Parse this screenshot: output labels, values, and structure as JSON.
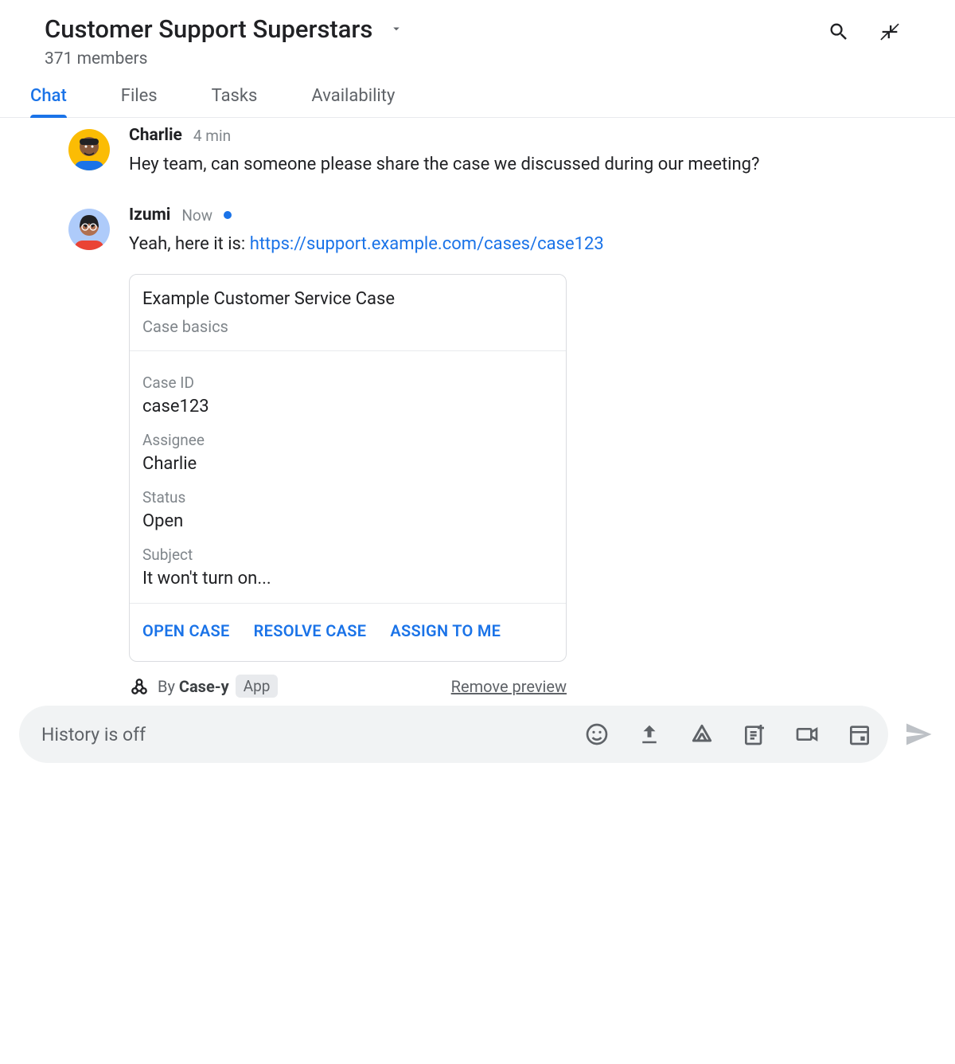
{
  "header": {
    "title": "Customer Support Superstars",
    "members": "371 members"
  },
  "tabs": [
    {
      "label": "Chat",
      "active": true
    },
    {
      "label": "Files",
      "active": false
    },
    {
      "label": "Tasks",
      "active": false
    },
    {
      "label": "Availability",
      "active": false
    }
  ],
  "messages": [
    {
      "sender": "Charlie",
      "time": "4 min",
      "text": "Hey team, can someone please share the case we discussed during our meeting?"
    },
    {
      "sender": "Izumi",
      "time": "Now",
      "new": true,
      "text_prefix": "Yeah, here it is: ",
      "link_text": "https://support.example.com/cases/case123"
    }
  ],
  "card": {
    "title": "Example Customer Service Case",
    "subtitle": "Case basics",
    "fields": [
      {
        "label": "Case ID",
        "value": "case123"
      },
      {
        "label": "Assignee",
        "value": "Charlie"
      },
      {
        "label": "Status",
        "value": "Open"
      },
      {
        "label": "Subject",
        "value": "It won't turn on..."
      }
    ],
    "actions": [
      {
        "label": "OPEN CASE"
      },
      {
        "label": "RESOLVE CASE"
      },
      {
        "label": "ASSIGN TO ME"
      }
    ],
    "footer": {
      "by_prefix": "By ",
      "by_name": "Case-y",
      "badge": "App",
      "remove": "Remove preview"
    }
  },
  "composer": {
    "placeholder": "History is off"
  }
}
